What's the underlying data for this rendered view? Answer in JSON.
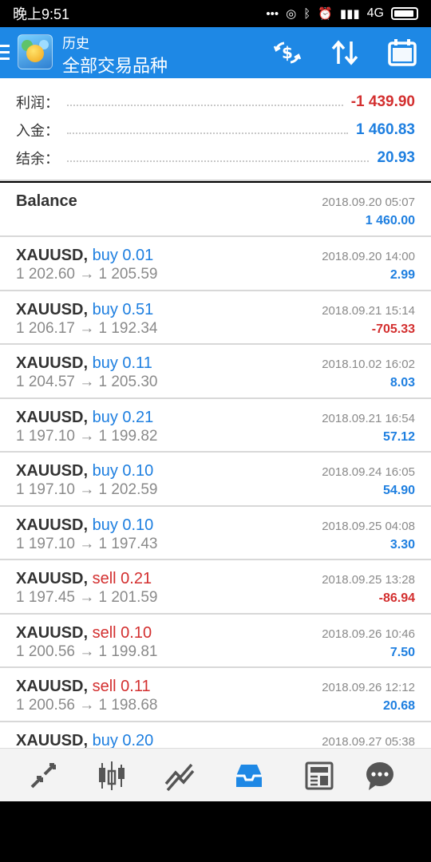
{
  "status_bar": {
    "time": "晚上9:51",
    "network": "4G"
  },
  "header": {
    "subtitle": "历史",
    "title": "全部交易品种",
    "icons": [
      "menu-icon",
      "app-logo",
      "currency-filter-icon",
      "sort-icon",
      "calendar-icon"
    ]
  },
  "summary": {
    "profit_label": "利润：",
    "profit_value": "-1 439.90",
    "deposit_label": "入金：",
    "deposit_value": "1 460.83",
    "balance_label": "结余：",
    "balance_value": "20.93"
  },
  "balance_entry": {
    "label": "Balance",
    "date": "2018.09.20 05:07",
    "amount": "1 460.00"
  },
  "trades": [
    {
      "symbol": "XAUUSD,",
      "type": "buy 0.01",
      "side": "buy",
      "prices": "1 202.60 → 1 205.59",
      "date": "2018.09.20 14:00",
      "profit": "2.99"
    },
    {
      "symbol": "XAUUSD,",
      "type": "buy 0.51",
      "side": "buy",
      "prices": "1 206.17 → 1 192.34",
      "date": "2018.09.21 15:14",
      "profit": "-705.33"
    },
    {
      "symbol": "XAUUSD,",
      "type": "buy 0.11",
      "side": "buy",
      "prices": "1 204.57 → 1 205.30",
      "date": "2018.10.02 16:02",
      "profit": "8.03"
    },
    {
      "symbol": "XAUUSD,",
      "type": "buy 0.21",
      "side": "buy",
      "prices": "1 197.10 → 1 199.82",
      "date": "2018.09.21 16:54",
      "profit": "57.12"
    },
    {
      "symbol": "XAUUSD,",
      "type": "buy 0.10",
      "side": "buy",
      "prices": "1 197.10 → 1 202.59",
      "date": "2018.09.24 16:05",
      "profit": "54.90"
    },
    {
      "symbol": "XAUUSD,",
      "type": "buy 0.10",
      "side": "buy",
      "prices": "1 197.10 → 1 197.43",
      "date": "2018.09.25 04:08",
      "profit": "3.30"
    },
    {
      "symbol": "XAUUSD,",
      "type": "sell 0.21",
      "side": "sell",
      "prices": "1 197.45 → 1 201.59",
      "date": "2018.09.25 13:28",
      "profit": "-86.94"
    },
    {
      "symbol": "XAUUSD,",
      "type": "sell 0.10",
      "side": "sell",
      "prices": "1 200.56 → 1 199.81",
      "date": "2018.09.26 10:46",
      "profit": "7.50"
    },
    {
      "symbol": "XAUUSD,",
      "type": "sell 0.11",
      "side": "sell",
      "prices": "1 200.56 → 1 198.68",
      "date": "2018.09.26 12:12",
      "profit": "20.68"
    },
    {
      "symbol": "XAUUSD,",
      "type": "buy 0.20",
      "side": "buy",
      "prices": "",
      "date": "2018.09.27 05:38",
      "profit": ""
    }
  ],
  "bottom_nav": {
    "items": [
      "quotes-icon",
      "chart-icon",
      "trade-icon",
      "history-icon",
      "news-icon",
      "chat-icon"
    ],
    "active": "history-icon"
  },
  "colors": {
    "accent": "#1e88e5",
    "positive": "#1e7fe0",
    "negative": "#d32f2f"
  }
}
